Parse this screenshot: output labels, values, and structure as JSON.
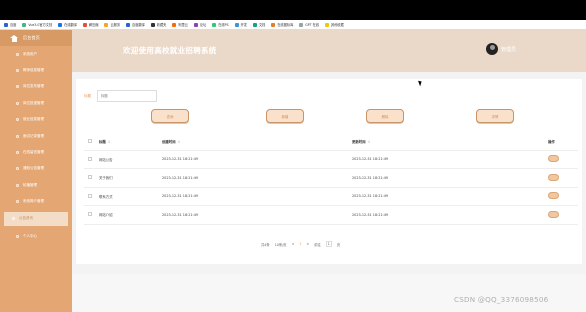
{
  "bookmarks": [
    {
      "label": "百度",
      "color": "#2b60d6"
    },
    {
      "label": "Vue3.0官方文档",
      "color": "#41b883"
    },
    {
      "label": "在线翻译",
      "color": "#1a73e8"
    },
    {
      "label": "解压缩",
      "color": "#e84c3d"
    },
    {
      "label": "云服务",
      "color": "#f5a623"
    },
    {
      "label": "百度翻译",
      "color": "#2b60d6"
    },
    {
      "label": "收藏夹",
      "color": "#333"
    },
    {
      "label": "阿里云",
      "color": "#ff6a00"
    },
    {
      "label": "论坛",
      "color": "#8e44ad"
    },
    {
      "label": "在线PS",
      "color": "#2ecc71"
    },
    {
      "label": "开发",
      "color": "#3498db"
    },
    {
      "label": "文档",
      "color": "#16a085"
    },
    {
      "label": "在线图标库",
      "color": "#e67e22"
    },
    {
      "label": "GPT 在线",
      "color": "#95a5a6"
    },
    {
      "label": "其他收藏",
      "color": "#f1c40f"
    }
  ],
  "sidebar": {
    "home": "后台首页",
    "items": [
      {
        "label": "系统用户"
      },
      {
        "label": "教师信息管理"
      },
      {
        "label": "岗位发布管理"
      },
      {
        "label": "岗位投递管理"
      },
      {
        "label": "就业信息管理"
      },
      {
        "label": "面试记录管理"
      },
      {
        "label": "在线留言管理"
      },
      {
        "label": "通知公告管理"
      },
      {
        "label": "轮播管理"
      },
      {
        "label": "系统简介管理"
      },
      {
        "label": "公告资讯",
        "active": true
      },
      {
        "label": "个人中心"
      }
    ]
  },
  "header": {
    "title": "欢迎使用高校就业招聘系统",
    "user": "管理员"
  },
  "search": {
    "label": "标题",
    "placeholder": "标题"
  },
  "buttons": {
    "query": "查询",
    "add": "新增",
    "delete": "删除",
    "extra": "详情"
  },
  "table": {
    "headers": [
      "标题",
      "创建时间",
      "更新时间",
      "操作"
    ],
    "rows": [
      {
        "title": "网站公告",
        "created": "2023-12-31 18:21:49",
        "updated": "2023-12-31 18:21:49"
      },
      {
        "title": "关于我们",
        "created": "2023-12-31 18:21:49",
        "updated": "2023-12-31 18:21:49"
      },
      {
        "title": "联系方式",
        "created": "2023-12-31 18:21:49",
        "updated": "2023-12-31 18:21:49"
      },
      {
        "title": "网站介绍",
        "created": "2023-12-31 18:21:49",
        "updated": "2023-12-31 18:21:49"
      }
    ]
  },
  "pagination": {
    "total": "共4条",
    "per_page": "10条/页",
    "prev": "<",
    "page": "1",
    "next": ">",
    "goto": "前往",
    "goto_value": "1",
    "goto_unit": "页"
  },
  "watermark": "CSDN @QQ_3376098506"
}
